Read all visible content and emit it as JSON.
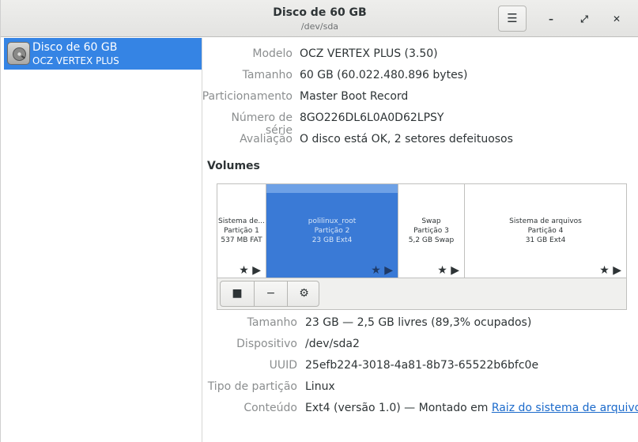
{
  "window": {
    "title": "Disco de 60 GB",
    "subtitle": "/dev/sda",
    "menu_icon": "☰",
    "minimize": "–",
    "maximize": "⤢",
    "close": "✕"
  },
  "sidebar": {
    "drive": {
      "name": "Disco de 60 GB",
      "model": "OCZ VERTEX PLUS",
      "icon": "disk-icon"
    }
  },
  "disk": {
    "model_label": "Modelo",
    "model_value": "OCZ VERTEX PLUS (3.50)",
    "size_label": "Tamanho",
    "size_value": "60 GB (60.022.480.896 bytes)",
    "partitioning_label": "Particionamento",
    "partitioning_value": "Master Boot Record",
    "serial_label": "Número de série",
    "serial_value": "8GO226DL6L0A0D62LPSY",
    "assessment_label": "Avaliação",
    "assessment_value": "O disco está OK, 2 setores defeituosos"
  },
  "volumes": {
    "heading": "Volumes",
    "partitions": [
      {
        "name": "Sistema de...",
        "number": "Partição 1",
        "info": "537 MB FAT"
      },
      {
        "name": "polilinux_root",
        "number": "Partição 2",
        "info": "23 GB Ext4"
      },
      {
        "name": "Swap",
        "number": "Partição 3",
        "info": "5,2 GB Swap"
      },
      {
        "name": "Sistema de arquivos",
        "number": "Partição 4",
        "info": "31 GB Ext4"
      }
    ],
    "icons": "★ ▶",
    "toolbar": {
      "stop": "■",
      "remove": "−",
      "settings": "⚙"
    }
  },
  "selected": {
    "size_label": "Tamanho",
    "size_value": "23 GB — 2,5 GB livres (89,3% ocupados)",
    "device_label": "Dispositivo",
    "device_value": "/dev/sda2",
    "uuid_label": "UUID",
    "uuid_value": "25efb224-3018-4a81-8b73-65522b6bfc0e",
    "type_label": "Tipo de partição",
    "type_value": "Linux",
    "contents_label": "Conteúdo",
    "contents_prefix": "Ext4 (versão 1.0) — Montado em ",
    "contents_link": "Raiz do sistema de arquivos"
  }
}
